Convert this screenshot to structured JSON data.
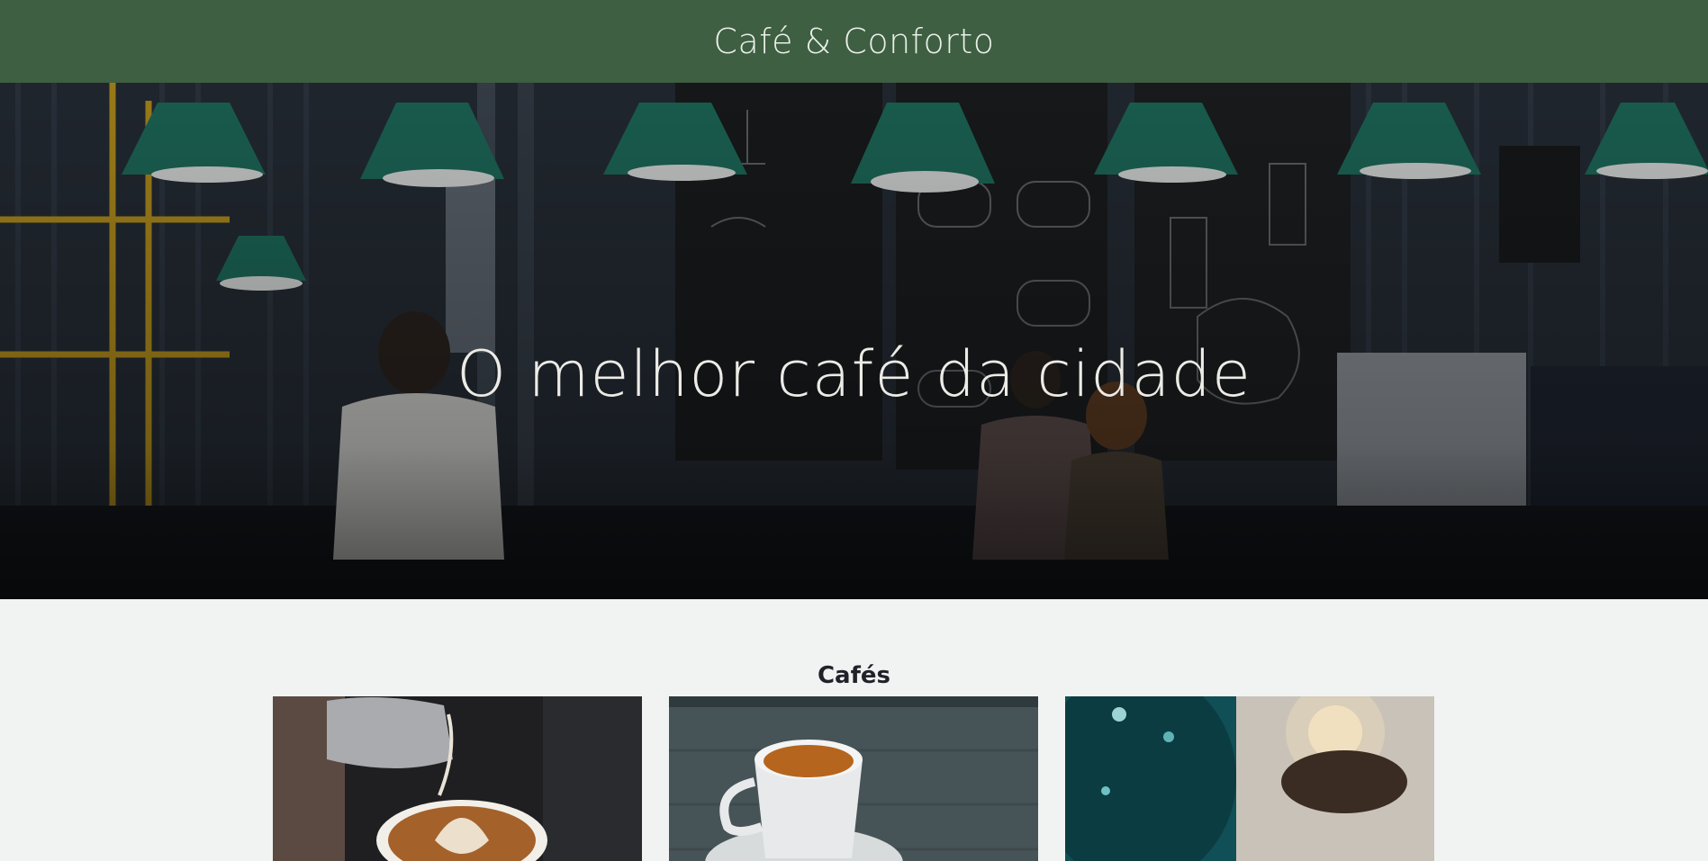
{
  "header": {
    "brand": "Café & Conforto"
  },
  "hero": {
    "title": "O melhor café da cidade",
    "image": "coffee-shop-interior-photo"
  },
  "section": {
    "title": "Cafés"
  },
  "cards": [
    {
      "image": "latte-art-pour-photo"
    },
    {
      "image": "espresso-cup-photo"
    },
    {
      "image": "teal-mug-bokeh-photo"
    }
  ],
  "colors": {
    "header_bg": "#3e5f41",
    "page_bg": "#f1f3f2",
    "lamp_green": "#1f6f5e"
  }
}
